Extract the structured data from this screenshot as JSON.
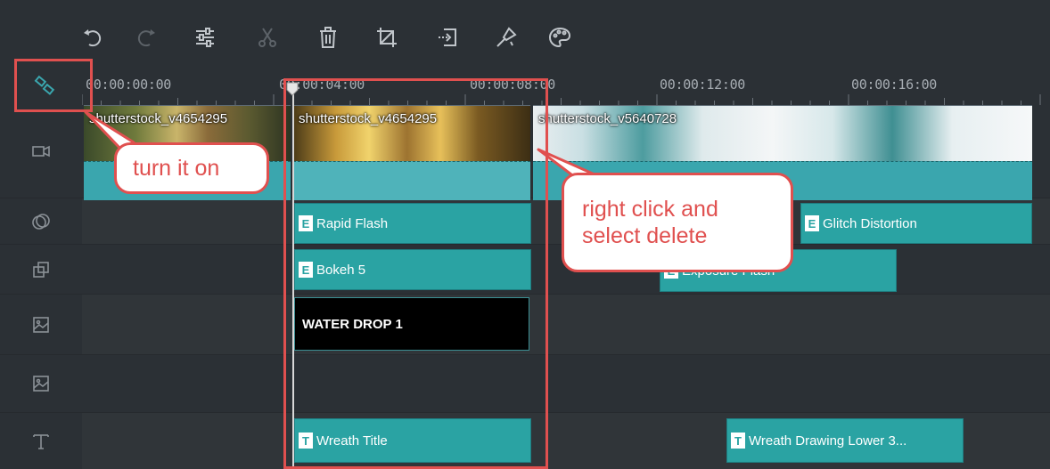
{
  "toolbar": {
    "icons": [
      "undo-icon",
      "redo-icon",
      "adjust-icon",
      "cut-icon",
      "delete-icon",
      "crop-icon",
      "export-icon",
      "effect-icon",
      "palette-icon"
    ]
  },
  "ruler": {
    "times": [
      "00:00:00:00",
      "00:00:04:00",
      "00:00:08:00",
      "00:00:12:00",
      "00:00:16:00"
    ]
  },
  "tracks": {
    "video": {
      "clips": [
        {
          "name": "shutterstock_v4654295"
        },
        {
          "name": "shutterstock_v4654295"
        },
        {
          "name": "shutterstock_v5640728"
        }
      ]
    },
    "effects_row1": {
      "clips": [
        {
          "badge": "E",
          "name": "Rapid Flash"
        },
        {
          "badge": "E",
          "name": "Glitch Distortion"
        }
      ]
    },
    "effects_row2": {
      "clips": [
        {
          "badge": "E",
          "name": "Bokeh 5"
        },
        {
          "badge": "E",
          "name": "Exposure Flash"
        }
      ]
    },
    "overlay_row1": {
      "clips": [
        {
          "name": "WATER DROP 1"
        }
      ]
    },
    "title_row": {
      "clips": [
        {
          "badge": "T",
          "name": "Wreath Title"
        },
        {
          "badge": "T",
          "name": "Wreath Drawing Lower 3..."
        }
      ]
    }
  },
  "annotations": {
    "turn_on": "turn it on",
    "right_click_line1": "right click and",
    "right_click_line2": "select delete"
  },
  "colors": {
    "background": "#2b3035",
    "clip_teal": "#2aa3a3",
    "annotation_red": "#e0504f"
  }
}
